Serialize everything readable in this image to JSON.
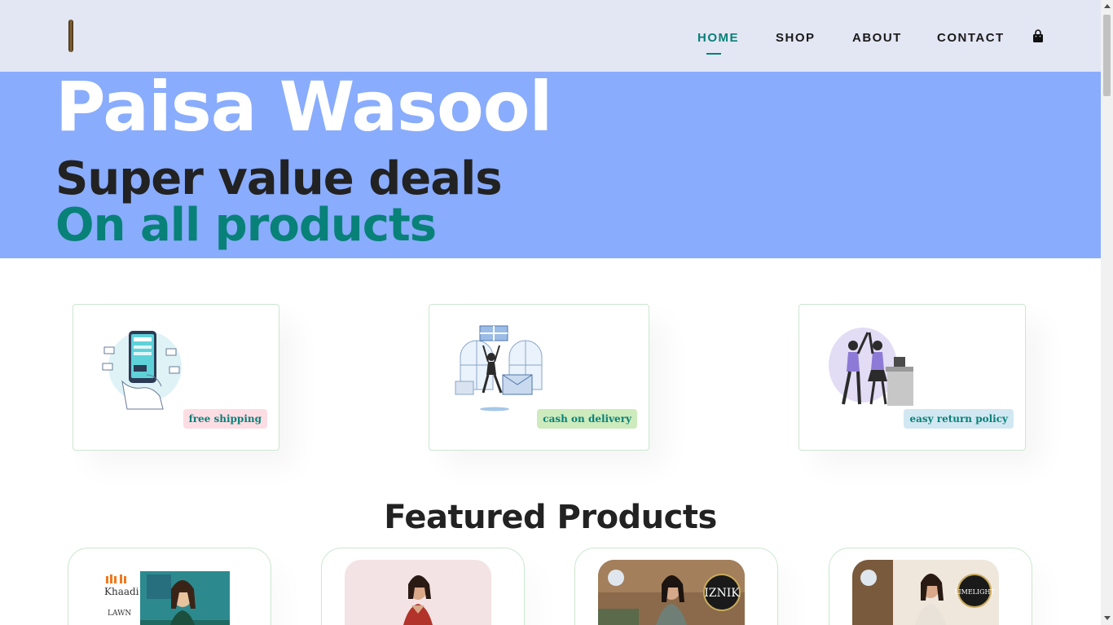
{
  "header": {
    "logo_icon": "brand-logo-icon",
    "nav": [
      {
        "label": "HOME",
        "active": true
      },
      {
        "label": "SHOP",
        "active": false
      },
      {
        "label": "ABOUT",
        "active": false
      },
      {
        "label": "CONTACT",
        "active": false
      }
    ],
    "cart_icon": "shopping-bag-icon",
    "accent_color": "#088178",
    "background_color": "#e3e6f3"
  },
  "hero": {
    "title": "Paisa Wasool",
    "subtitle_line1": "Super value deals",
    "subtitle_line2": "On all products",
    "background_color": "#89acfd"
  },
  "features": [
    {
      "label": "free shipping",
      "icon": "phone-shopping-illustration",
      "badge_color": "#fddde4"
    },
    {
      "label": "cash on delivery",
      "icon": "delivery-gift-illustration",
      "badge_color": "#cdebbc"
    },
    {
      "label": "easy return policy",
      "icon": "high-five-illustration",
      "badge_color": "#d1e8f2"
    }
  ],
  "featured": {
    "title": "Featured Products",
    "products": [
      {
        "image": "khaadi-lawn-product-image",
        "brand_text": "Khaadi",
        "sub_text": "LAWN"
      },
      {
        "image": "red-dress-product-image"
      },
      {
        "image": "iznik-product-image",
        "brand_text": "IZNIK"
      },
      {
        "image": "limelight-product-image",
        "brand_text": "LIMELIGHT"
      }
    ]
  }
}
